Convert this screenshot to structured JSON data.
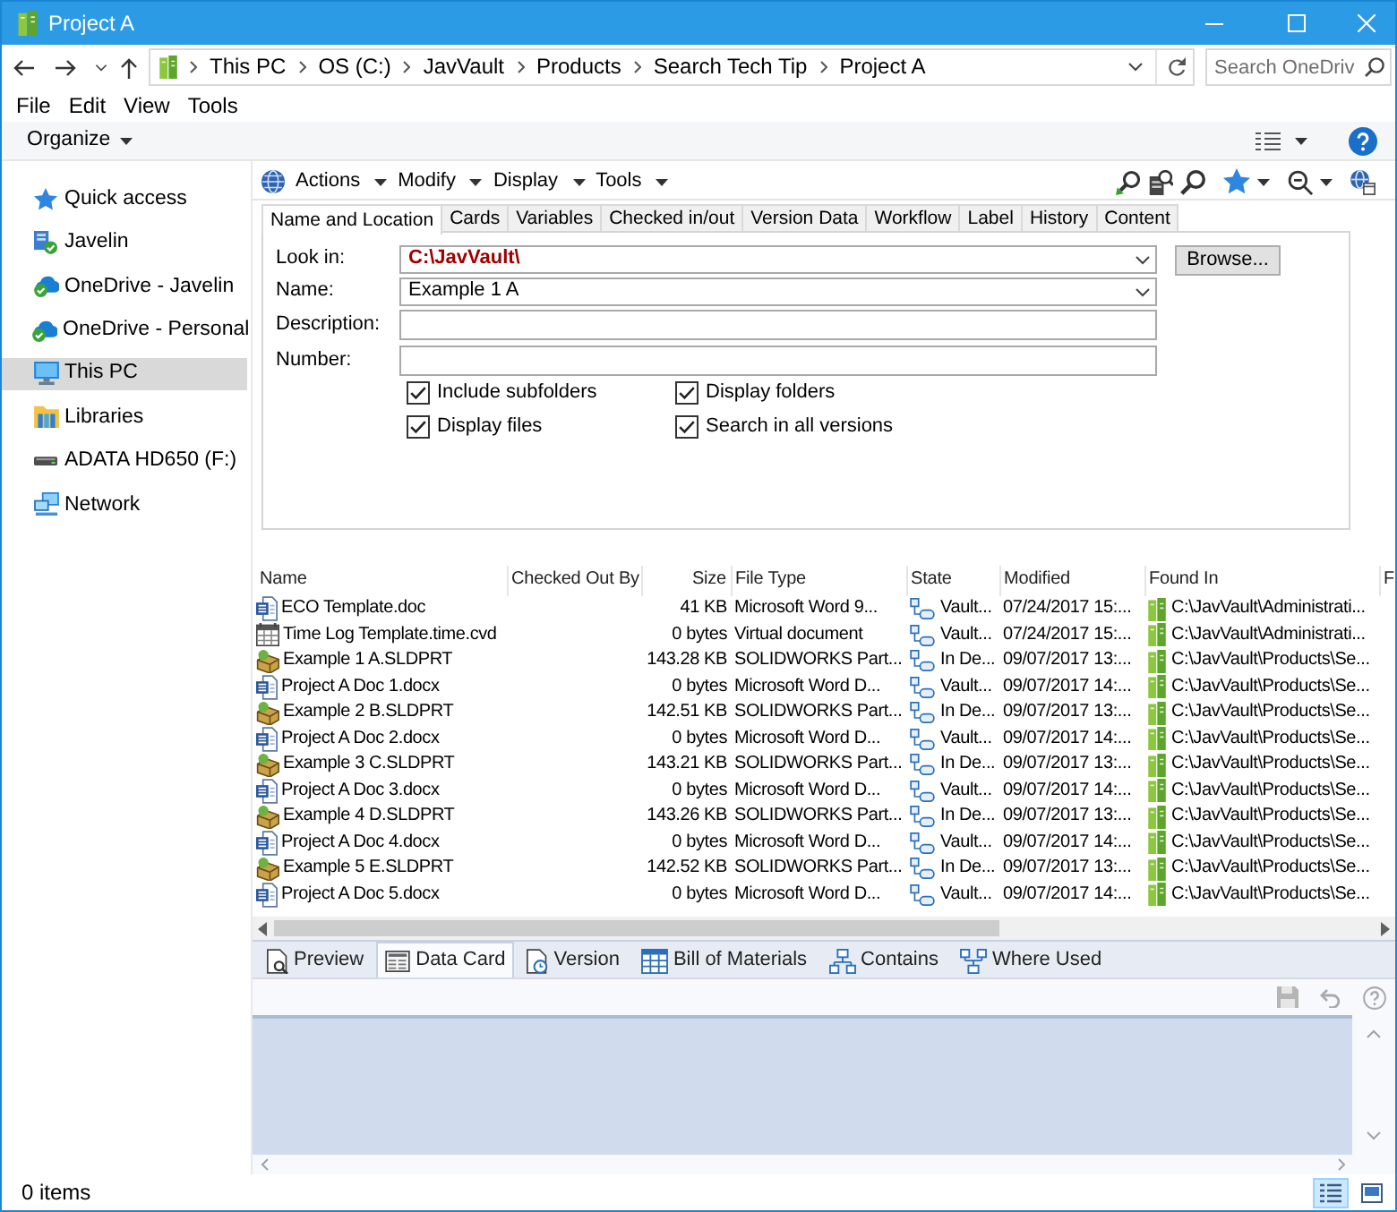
{
  "window": {
    "title": "Project A"
  },
  "address_bar": {
    "path": [
      "This PC",
      "OS (C:)",
      "JavVault",
      "Products",
      "Search Tech Tip",
      "Project A"
    ]
  },
  "search": {
    "placeholder": "Search OneDriv"
  },
  "menu": [
    "File",
    "Edit",
    "View",
    "Tools"
  ],
  "command_bar": {
    "organize": "Organize"
  },
  "navigation": [
    {
      "label": "Quick access",
      "kind": "quick_access",
      "selected": false
    },
    {
      "label": "Javelin",
      "kind": "server",
      "selected": false
    },
    {
      "label": "OneDrive - Javelin",
      "kind": "cloud",
      "selected": false
    },
    {
      "label": "OneDrive - Personal",
      "kind": "cloud",
      "selected": false
    },
    {
      "label": "This PC",
      "kind": "computer",
      "selected": true
    },
    {
      "label": "Libraries",
      "kind": "libraries",
      "selected": false
    },
    {
      "label": "ADATA HD650 (F:)",
      "kind": "drive",
      "selected": false
    },
    {
      "label": "Network",
      "kind": "network",
      "selected": false
    }
  ],
  "vault_toolbar": {
    "menus": [
      "Actions",
      "Modify",
      "Display",
      "Tools"
    ]
  },
  "search_tabs": [
    {
      "label": "Name and Location",
      "selected": true
    },
    {
      "label": "Cards",
      "selected": false
    },
    {
      "label": "Variables",
      "selected": false
    },
    {
      "label": "Checked in/out",
      "selected": false
    },
    {
      "label": "Version Data",
      "selected": false
    },
    {
      "label": "Workflow",
      "selected": false
    },
    {
      "label": "Label",
      "selected": false
    },
    {
      "label": "History",
      "selected": false
    },
    {
      "label": "Content",
      "selected": false
    }
  ],
  "search_form": {
    "fields": [
      {
        "label": "Look in:",
        "kind": "path",
        "value": "C:\\JavVault\\"
      },
      {
        "label": "Name:",
        "kind": "combo",
        "value": "Example 1 A"
      },
      {
        "label": "Description:",
        "kind": "text"
      },
      {
        "label": "Number:",
        "kind": "text"
      }
    ],
    "browse_button": "Browse...",
    "options": [
      {
        "label": "Include subfolders",
        "checked": true
      },
      {
        "label": "Display folders",
        "checked": true
      },
      {
        "label": "Display files",
        "checked": true
      },
      {
        "label": "Search in all versions",
        "checked": true
      }
    ]
  },
  "results": {
    "columns": [
      "Name",
      "Checked Out By",
      "Size",
      "File Type",
      "State",
      "Modified",
      "Found In",
      "F"
    ],
    "rows": [
      {
        "kind": "word",
        "name": "ECO Template.doc",
        "size": "41 KB",
        "file_type": "Microsoft Word 9...",
        "state": "Vault...",
        "modified": "07/24/2017 15:...",
        "found_in": "C:\\JavVault\\Administrati..."
      },
      {
        "kind": "virtual",
        "name": "Time Log Template.time.cvd",
        "size": "0 bytes",
        "file_type": "Virtual document",
        "state": "Vault...",
        "modified": "07/24/2017 15:...",
        "found_in": "C:\\JavVault\\Administrati..."
      },
      {
        "kind": "part",
        "name": "Example 1 A.SLDPRT",
        "size": "143.28 KB",
        "file_type": "SOLIDWORKS Part...",
        "state": "In De...",
        "modified": "09/07/2017 13:...",
        "found_in": "C:\\JavVault\\Products\\Se..."
      },
      {
        "kind": "word",
        "name": "Project A Doc 1.docx",
        "size": "0 bytes",
        "file_type": "Microsoft Word D...",
        "state": "Vault...",
        "modified": "09/07/2017 14:...",
        "found_in": "C:\\JavVault\\Products\\Se..."
      },
      {
        "kind": "part",
        "name": "Example 2 B.SLDPRT",
        "size": "142.51 KB",
        "file_type": "SOLIDWORKS Part...",
        "state": "In De...",
        "modified": "09/07/2017 13:...",
        "found_in": "C:\\JavVault\\Products\\Se..."
      },
      {
        "kind": "word",
        "name": "Project A Doc 2.docx",
        "size": "0 bytes",
        "file_type": "Microsoft Word D...",
        "state": "Vault...",
        "modified": "09/07/2017 14:...",
        "found_in": "C:\\JavVault\\Products\\Se..."
      },
      {
        "kind": "part",
        "name": "Example 3 C.SLDPRT",
        "size": "143.21 KB",
        "file_type": "SOLIDWORKS Part...",
        "state": "In De...",
        "modified": "09/07/2017 13:...",
        "found_in": "C:\\JavVault\\Products\\Se..."
      },
      {
        "kind": "word",
        "name": "Project A Doc 3.docx",
        "size": "0 bytes",
        "file_type": "Microsoft Word D...",
        "state": "Vault...",
        "modified": "09/07/2017 14:...",
        "found_in": "C:\\JavVault\\Products\\Se..."
      },
      {
        "kind": "part",
        "name": "Example 4 D.SLDPRT",
        "size": "143.26 KB",
        "file_type": "SOLIDWORKS Part...",
        "state": "In De...",
        "modified": "09/07/2017 13:...",
        "found_in": "C:\\JavVault\\Products\\Se..."
      },
      {
        "kind": "word",
        "name": "Project A Doc 4.docx",
        "size": "0 bytes",
        "file_type": "Microsoft Word D...",
        "state": "Vault...",
        "modified": "09/07/2017 14:...",
        "found_in": "C:\\JavVault\\Products\\Se..."
      },
      {
        "kind": "part",
        "name": "Example 5 E.SLDPRT",
        "size": "142.52 KB",
        "file_type": "SOLIDWORKS Part...",
        "state": "In De...",
        "modified": "09/07/2017 13:...",
        "found_in": "C:\\JavVault\\Products\\Se..."
      },
      {
        "kind": "word",
        "name": "Project A Doc 5.docx",
        "size": "0 bytes",
        "file_type": "Microsoft Word D...",
        "state": "Vault...",
        "modified": "09/07/2017 14:...",
        "found_in": "C:\\JavVault\\Products\\Se..."
      }
    ]
  },
  "preview_tabs": [
    {
      "label": "Preview",
      "kind": "preview",
      "selected": false
    },
    {
      "label": "Data Card",
      "kind": "data_card",
      "selected": true
    },
    {
      "label": "Version",
      "kind": "version",
      "selected": false
    },
    {
      "label": "Bill of Materials",
      "kind": "bom",
      "selected": false
    },
    {
      "label": "Contains",
      "kind": "contains",
      "selected": false
    },
    {
      "label": "Where Used",
      "kind": "where_used",
      "selected": false
    }
  ],
  "status_bar": {
    "text": "0 items",
    "views": [
      {
        "kind": "details",
        "selected": true
      },
      {
        "kind": "thumbnails",
        "selected": false
      }
    ]
  }
}
